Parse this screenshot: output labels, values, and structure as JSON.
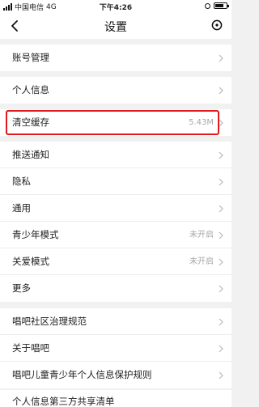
{
  "status_bar": {
    "carrier": "中国电信",
    "network": "4G",
    "time": "下午4:26"
  },
  "nav": {
    "title": "设置",
    "back_icon": "chevron-left-icon",
    "record_icon": "record-icon"
  },
  "groups": [
    {
      "items": [
        {
          "label": "账号管理"
        }
      ]
    },
    {
      "items": [
        {
          "label": "个人信息"
        }
      ]
    },
    {
      "items": [
        {
          "label": "清空缓存",
          "value": "5.43M",
          "highlighted": true
        }
      ]
    },
    {
      "items": [
        {
          "label": "推送通知"
        },
        {
          "label": "隐私"
        },
        {
          "label": "通用"
        },
        {
          "label": "青少年模式",
          "value": "未开启"
        },
        {
          "label": "关爱模式",
          "value": "未开启"
        },
        {
          "label": "更多"
        }
      ]
    },
    {
      "items": [
        {
          "label": "唱吧社区治理规范"
        },
        {
          "label": "关于唱吧"
        },
        {
          "label": "唱吧儿童青少年个人信息保护规则"
        },
        {
          "label": "个人信息第三方共享清单"
        }
      ]
    }
  ],
  "colors": {
    "background": "#f1f1f1",
    "highlight_border": "#e0191d",
    "secondary_text": "#a8a8a8"
  }
}
